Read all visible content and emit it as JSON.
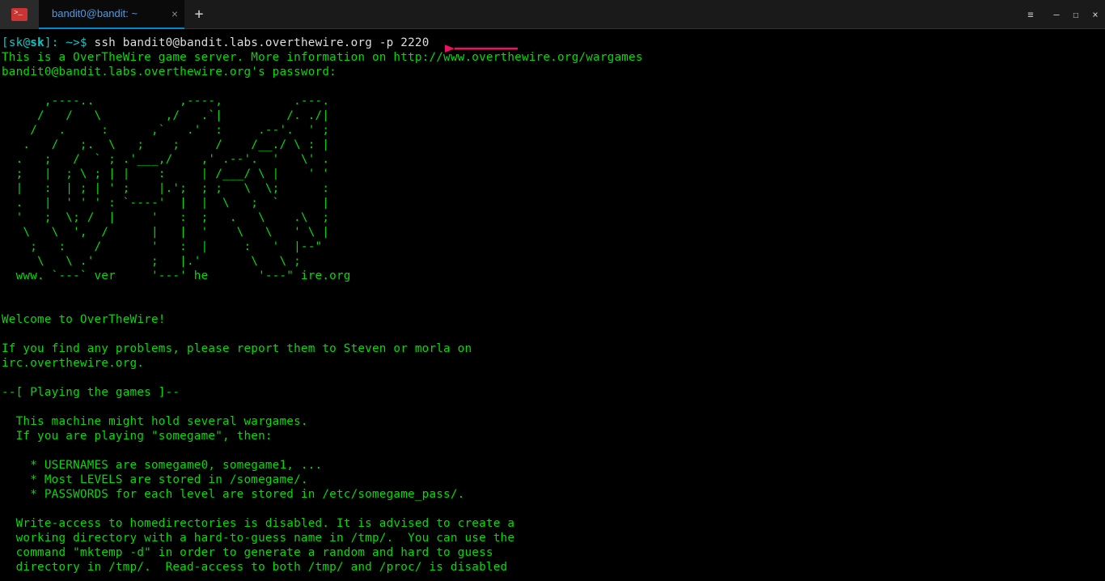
{
  "titlebar": {
    "tab_title": "bandit0@bandit: ~",
    "tab_close": "×",
    "new_tab": "+",
    "menu_icon": "≡",
    "minimize": "—",
    "maximize": "☐",
    "close": "×"
  },
  "prompt": {
    "bracket_open": "[",
    "user": "sk",
    "at": "@",
    "host": "sk",
    "bracket_close": "]",
    "path": ": ~>$ ",
    "command": "ssh bandit0@bandit.labs.overthewire.org -p 2220"
  },
  "lines": {
    "banner": "This is a OverTheWire game server. More information on http://www.overthewire.org/wargames",
    "password_prompt": "bandit0@bandit.labs.overthewire.org's password:",
    "ascii_art": "      ,----..            ,----,          .---.\n     /   /   \\         ,/   .`|         /. ./|\n    /   .     :      ,`   .'  :     .--'.  ' ;\n   .   /   ;.  \\   ;    ;     /    /__./ \\ : |\n  .   ;   /  ` ; .'___,/    ,' .--'.  '   \\' .\n  ;   |  ; \\ ; | |    :     | /___/ \\ |    ' '\n  |   :  | ; | ' ;    |.';  ; ;   \\  \\;      :\n  .   |  ' ' ' : `----'  |  |  \\   ;  `      |\n  '   ;  \\; /  |     '   :  ;   .   \\    .\\  ;\n   \\   \\  ',  /      |   |  '    \\   \\   ' \\ |\n    ;   :    /       '   :  |     :   '  |--\"\n     \\   \\ .'        ;   |.'       \\   \\ ;\n  www. `---` ver     '---' he       '---\" ire.org",
    "welcome": "Welcome to OverTheWire!",
    "report1": "If you find any problems, please report them to Steven or morla on",
    "report2": "irc.overthewire.org.",
    "section1": "--[ Playing the games ]--",
    "game1": "  This machine might hold several wargames.",
    "game2": "  If you are playing \"somegame\", then:",
    "game3": "    * USERNAMES are somegame0, somegame1, ...",
    "game4": "    * Most LEVELS are stored in /somegame/.",
    "game5": "    * PASSWORDS for each level are stored in /etc/somegame_pass/.",
    "write1": "  Write-access to homedirectories is disabled. It is advised to create a",
    "write2": "  working directory with a hard-to-guess name in /tmp/.  You can use the",
    "write3": "  command \"mktemp -d\" in order to generate a random and hard to guess",
    "write4": "  directory in /tmp/.  Read-access to both /tmp/ and /proc/ is disabled"
  }
}
